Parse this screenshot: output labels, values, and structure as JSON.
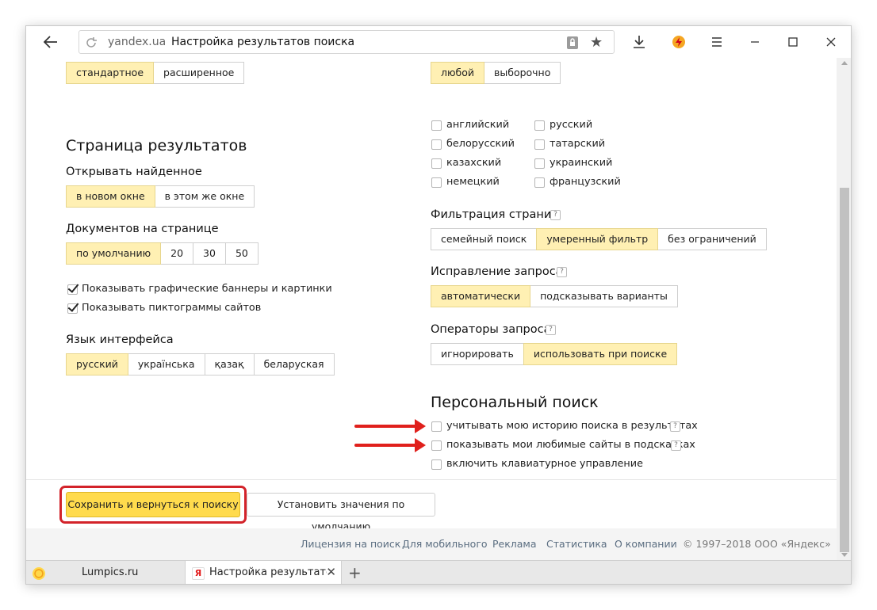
{
  "browser": {
    "domain": "yandex.ua",
    "title": "Настройка результатов поиска",
    "window_controls": {
      "minimize": "—",
      "maximize": "☐",
      "close": "✕"
    }
  },
  "left": {
    "top_segment": [
      {
        "label": "стандартное",
        "selected": true
      },
      {
        "label": "расширенное",
        "selected": false
      }
    ],
    "results_page": {
      "heading": "Страница результатов",
      "open_found": {
        "label": "Открывать найденное",
        "options": [
          {
            "label": "в новом окне",
            "selected": true
          },
          {
            "label": "в этом же окне",
            "selected": false
          }
        ]
      },
      "docs_per_page": {
        "label": "Документов на странице",
        "options": [
          {
            "label": "по умолчанию",
            "selected": true
          },
          {
            "label": "20",
            "selected": false
          },
          {
            "label": "30",
            "selected": false
          },
          {
            "label": "50",
            "selected": false
          }
        ]
      },
      "checkboxes": [
        {
          "label": "Показывать графические баннеры и картинки",
          "checked": true
        },
        {
          "label": "Показывать пиктограммы сайтов",
          "checked": true
        }
      ]
    },
    "interface_language": {
      "label": "Язык интерфейса",
      "options": [
        {
          "label": "русский",
          "selected": true
        },
        {
          "label": "українська",
          "selected": false
        },
        {
          "label": "қазақ",
          "selected": false
        },
        {
          "label": "беларуская",
          "selected": false
        }
      ]
    }
  },
  "right": {
    "language_segment": [
      {
        "label": "любой",
        "selected": true
      },
      {
        "label": "выборочно",
        "selected": false
      }
    ],
    "languages_col1": [
      "английский",
      "белорусский",
      "казахский",
      "немецкий"
    ],
    "languages_col2": [
      "русский",
      "татарский",
      "украинский",
      "французский"
    ],
    "page_filter": {
      "label": "Фильтрация страниц",
      "help": "?",
      "options": [
        {
          "label": "семейный поиск",
          "selected": false
        },
        {
          "label": "умеренный фильтр",
          "selected": true
        },
        {
          "label": "без ограничений",
          "selected": false
        }
      ]
    },
    "query_fix": {
      "label": "Исправление запроса",
      "help": "?",
      "options": [
        {
          "label": "автоматически",
          "selected": true
        },
        {
          "label": "подсказывать варианты",
          "selected": false
        }
      ]
    },
    "query_operators": {
      "label": "Операторы запроса",
      "help": "?",
      "options": [
        {
          "label": "игнорировать",
          "selected": false
        },
        {
          "label": "использовать при поиске",
          "selected": true
        }
      ]
    },
    "personal": {
      "heading": "Персональный поиск",
      "items": [
        {
          "label": "учитывать мою историю поиска в результатах",
          "help": "?",
          "checked": false
        },
        {
          "label": "показывать мои любимые сайты в подсказках",
          "help": "?",
          "checked": false
        },
        {
          "label": "включить клавиатурное управление",
          "checked": false
        }
      ]
    }
  },
  "actions": {
    "save": "Сохранить и вернуться к поиску",
    "defaults": "Установить значения по умолчанию"
  },
  "footer": {
    "links": [
      "Лицензия на поиск",
      "Для мобильного",
      "Реклама",
      "Статистика",
      "О компании"
    ],
    "copyright": "© 1997–2018 ООО «Яндекс»"
  },
  "tabs": [
    {
      "title": "Lumpics.ru",
      "active": false
    },
    {
      "title": "Настройка результатов поиска",
      "active": true,
      "favicon": "Я"
    }
  ],
  "new_tab": "+",
  "colors": {
    "selected_option": "#fff0b3",
    "save_button": "#ffdb4d",
    "annotation_red": "#e0201c"
  }
}
